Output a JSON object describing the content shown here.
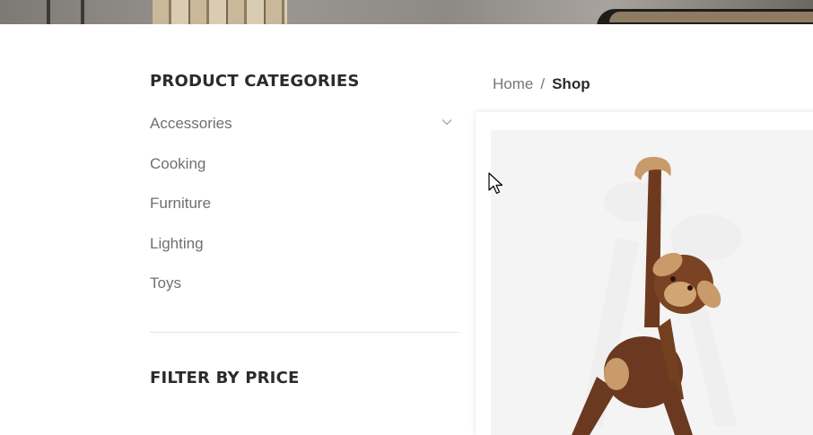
{
  "sidebar": {
    "categories_title": "PRODUCT CATEGORIES",
    "categories": [
      {
        "label": "Accessories",
        "has_children": true
      },
      {
        "label": "Cooking"
      },
      {
        "label": "Furniture"
      },
      {
        "label": "Lighting"
      },
      {
        "label": "Toys"
      }
    ],
    "price_title": "FILTER BY PRICE"
  },
  "breadcrumb": {
    "home": "Home",
    "separator": "/",
    "current": "Shop"
  },
  "product": {
    "image_icon": "wooden-monkey-toy"
  }
}
